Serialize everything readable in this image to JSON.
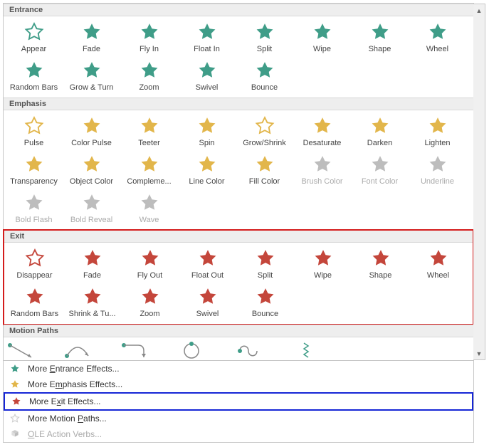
{
  "sections": {
    "entrance": {
      "header": "Entrance",
      "items": [
        "Appear",
        "Fade",
        "Fly In",
        "Float In",
        "Split",
        "Wipe",
        "Shape",
        "Wheel",
        "Random Bars",
        "Grow & Turn",
        "Zoom",
        "Swivel",
        "Bounce"
      ]
    },
    "emphasis": {
      "header": "Emphasis",
      "items": [
        "Pulse",
        "Color Pulse",
        "Teeter",
        "Spin",
        "Grow/Shrink",
        "Desaturate",
        "Darken",
        "Lighten",
        "Transparency",
        "Object Color",
        "Compleme...",
        "Line Color",
        "Fill Color",
        "Brush Color",
        "Font Color",
        "Underline",
        "Bold Flash",
        "Bold Reveal",
        "Wave"
      ],
      "disabled": [
        13,
        14,
        15,
        16,
        17,
        18
      ]
    },
    "exit": {
      "header": "Exit",
      "items": [
        "Disappear",
        "Fade",
        "Fly Out",
        "Float Out",
        "Split",
        "Wipe",
        "Shape",
        "Wheel",
        "Random Bars",
        "Shrink & Tu...",
        "Zoom",
        "Swivel",
        "Bounce"
      ]
    },
    "motion": {
      "header": "Motion Paths"
    }
  },
  "menu": {
    "entrance": "More Entrance Effects...",
    "emphasis": "More Emphasis Effects...",
    "exit": "More Exit Effects...",
    "motion": "More Motion Paths...",
    "ole": "OLE Action Verbs..."
  }
}
